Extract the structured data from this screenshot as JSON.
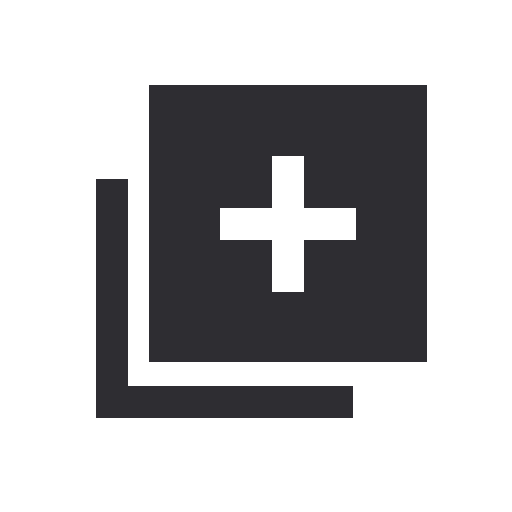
{
  "icon": {
    "name": "add-to-collection-icon",
    "color": "#2e2d32",
    "background": "#ffffff",
    "symbol": "plus"
  }
}
